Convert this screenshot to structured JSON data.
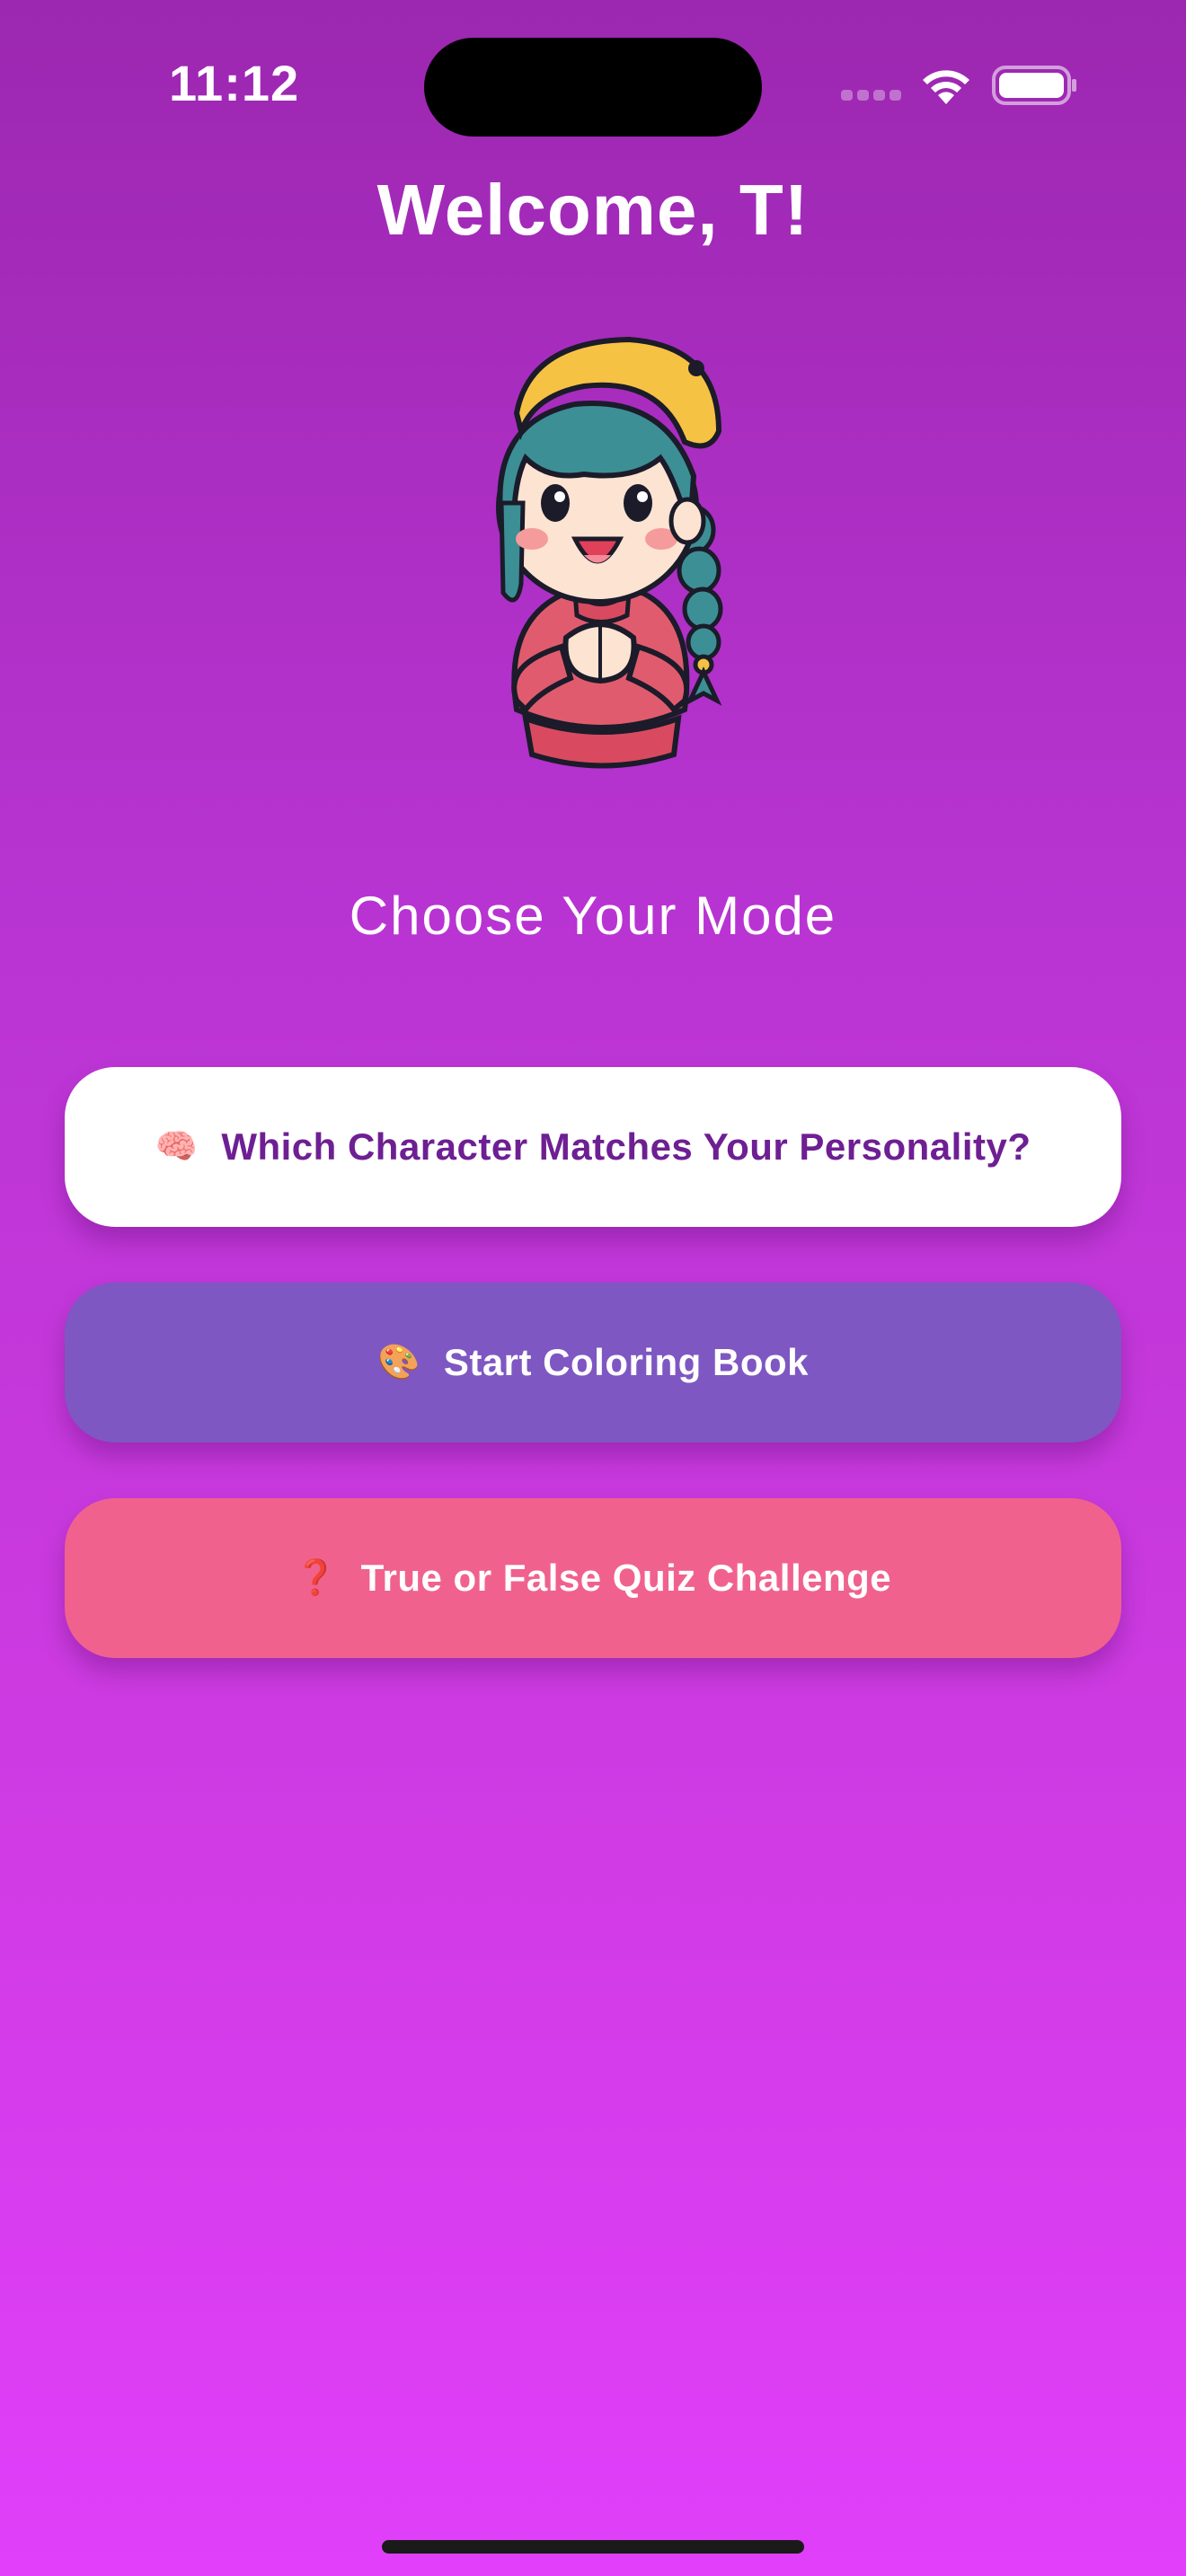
{
  "status_bar": {
    "time": "11:12",
    "icons": [
      "cellular-signal-icon",
      "wifi-icon",
      "battery-icon"
    ]
  },
  "header": {
    "title": "Welcome, T!"
  },
  "mascot": {
    "icon": "girl-character-illustration"
  },
  "main": {
    "subtitle": "Choose Your Mode",
    "buttons": [
      {
        "emoji": "🧠",
        "label": "Which Character Matches Your Personality?",
        "icon": "brain-icon"
      },
      {
        "emoji": "🎨",
        "label": "Start Coloring Book",
        "icon": "palette-icon"
      },
      {
        "emoji": "❓",
        "label": "True or False Quiz Challenge",
        "icon": "question-mark-icon"
      }
    ]
  },
  "colors": {
    "gradient_top": "#9c27b0",
    "gradient_bottom": "#e13ffa",
    "personality_button_bg": "#ffffff",
    "personality_button_text": "#6e1f93",
    "coloring_button_bg": "#7e57c2",
    "quiz_button_bg": "#f0628d"
  }
}
